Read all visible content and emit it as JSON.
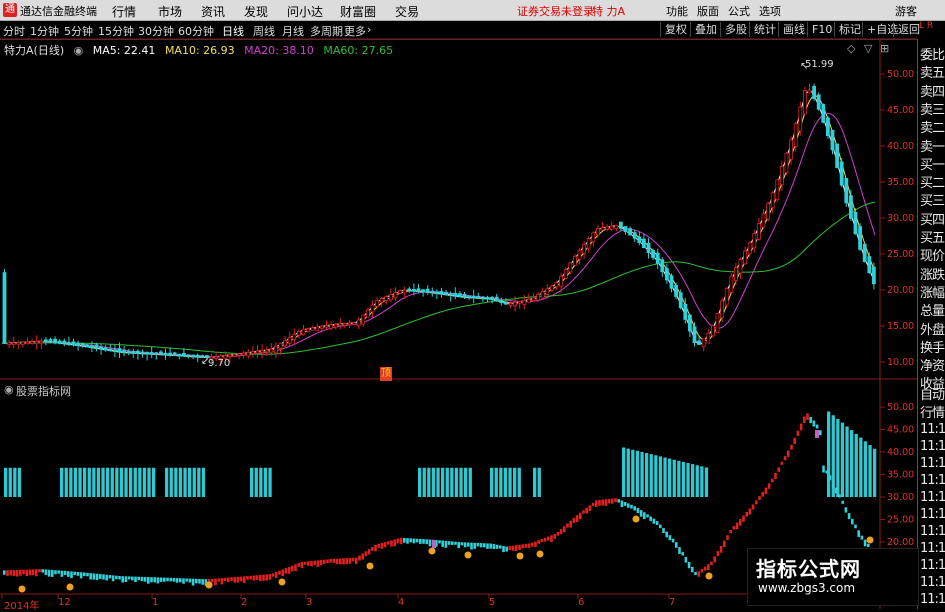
{
  "titlebar": {
    "app_name": "通达信金融终端",
    "menus": [
      "行情",
      "市场",
      "资讯",
      "发现",
      "问小达",
      "财富圈",
      "交易"
    ],
    "login_notice": "证券交易未登录",
    "stock_name": "特 力A",
    "right_menus": [
      "功能",
      "版面",
      "公式",
      "选项"
    ],
    "user": "游客",
    "logo_glyph": "通"
  },
  "period_tabs": [
    "分时",
    "1分钟",
    "5分钟",
    "15分钟",
    "30分钟",
    "60分钟",
    "日线",
    "周线",
    "月线",
    "多周期",
    "更多"
  ],
  "active_period": "日线",
  "toolbar": [
    "复权",
    "叠加",
    "多股",
    "统计",
    "画线",
    "F10",
    "标记",
    "+自选",
    "返回"
  ],
  "legend": {
    "stock": "特力A(日线)",
    "ma5": "MA5: 22.41",
    "ma10": "MA10: 26.93",
    "ma20": "MA20: 38.10",
    "ma60": "MA60: 27.65"
  },
  "colors": {
    "up": "#e02020",
    "down": "#30d0d8",
    "ma5": "#ffffff",
    "ma10": "#f0e060",
    "ma20": "#d040d0",
    "ma60": "#30c030",
    "bar": "#30c8d0",
    "pink": "#c060c0"
  },
  "sidebar_items": [
    "委比",
    "卖五",
    "卖四",
    "卖三",
    "卖二",
    "卖一",
    "买一",
    "买二",
    "买三",
    "买四",
    "买五",
    "现价",
    "涨跌",
    "涨幅",
    "总量",
    "外盘",
    "换手",
    "净资",
    "收益",
    "自动",
    "行情",
    "11:1",
    "11:1",
    "11:1",
    "11:1",
    "11:1",
    "11:1",
    "11:1",
    "11:1",
    "11:1",
    "11:1",
    "11:1"
  ],
  "price_axis": [
    "50.00",
    "45.00",
    "40.00",
    "35.00",
    "30.00",
    "25.00",
    "20.00",
    "15.00",
    "10.00"
  ],
  "indicator_axis": [
    "50.00",
    "45.00",
    "40.00",
    "35.00",
    "30.00",
    "25.00",
    "20.00",
    "15.00",
    "10.00"
  ],
  "annotations": {
    "high": "51.99",
    "low": "9.70",
    "ding": "顶"
  },
  "indicator_title": "股票指标网",
  "x_labels": [
    "2014年",
    "12",
    "1",
    "2",
    "3",
    "4",
    "5",
    "6",
    "7"
  ],
  "watermark": {
    "title": "指标公式网",
    "url": "www.zbgs3.com"
  }
}
